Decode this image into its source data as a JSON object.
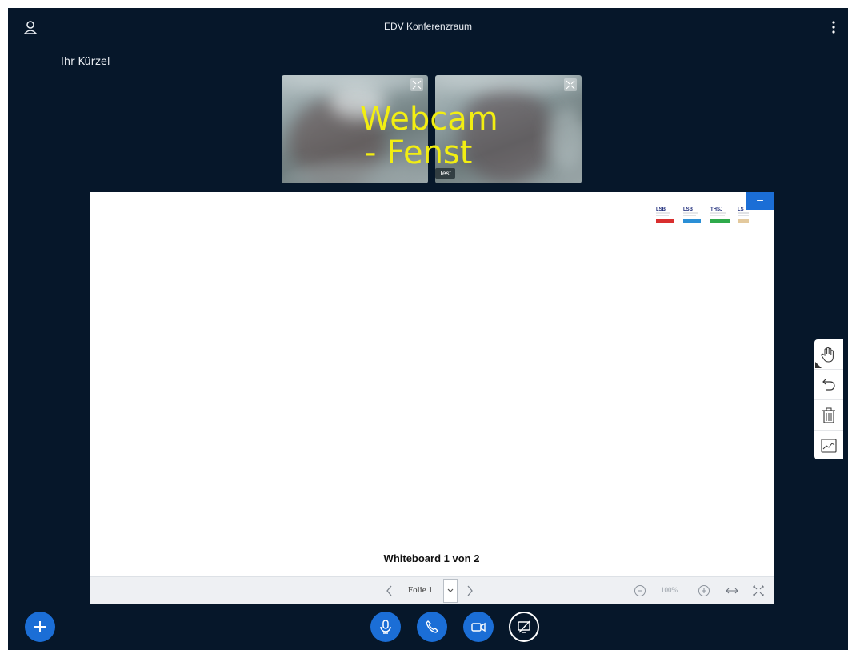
{
  "header": {
    "room_title": "EDV Konferenzraum"
  },
  "user_panel": {
    "initials_label": "Ihr Kürzel"
  },
  "webcams": [
    {
      "name": ""
    },
    {
      "name": "Test"
    }
  ],
  "overlay_annotation": {
    "line1": "Webcam",
    "line2": "- Fenst"
  },
  "whiteboard": {
    "title": "Whiteboard 1 von 2",
    "minimize_label": "–",
    "slide_label": "Folie 1",
    "zoom_level": "100%",
    "logos": [
      "LSB",
      "LSB",
      "THSJ",
      "LS"
    ]
  },
  "side_tools": {
    "items": [
      "hand-tool",
      "undo",
      "clear",
      "multi-user"
    ]
  },
  "bottom_bar": {
    "actions": [
      "plus",
      "microphone",
      "phone",
      "video",
      "screen-share"
    ]
  },
  "colors": {
    "background": "#06172a",
    "accent": "#1b6ed6",
    "overlay_text": "#f2ee12"
  }
}
